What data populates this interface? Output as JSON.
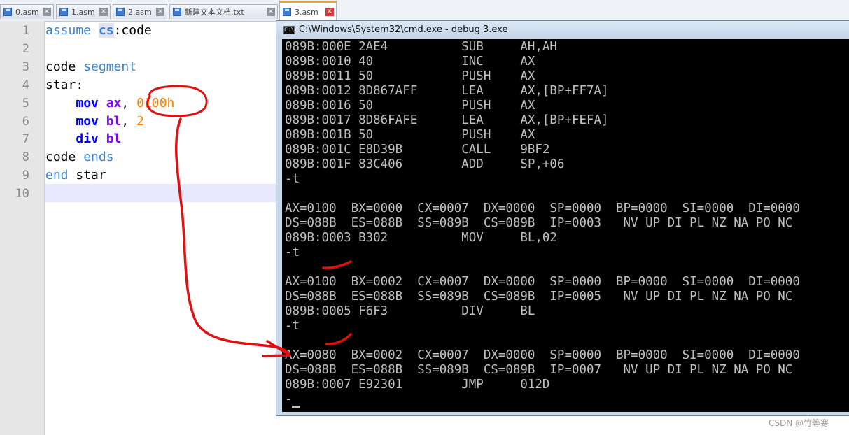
{
  "tabs": [
    {
      "label": "0.asm",
      "active": false
    },
    {
      "label": "1.asm",
      "active": false
    },
    {
      "label": "2.asm",
      "active": false
    },
    {
      "label": "新建文本文档.txt",
      "active": false
    },
    {
      "label": "3.asm",
      "active": true
    }
  ],
  "editor": {
    "line_numbers": [
      "1",
      "2",
      "3",
      "4",
      "5",
      "6",
      "7",
      "8",
      "9",
      "10"
    ],
    "lines": [
      {
        "kw": "assume",
        "sp": " ",
        "seg": "cs",
        "rest": ":code"
      },
      {},
      {
        "name": "code",
        "sp": " ",
        "kw": "segment"
      },
      {
        "label": "star:"
      },
      {
        "indent": "    ",
        "op": "mov",
        "sp": " ",
        "reg": "ax",
        "sep": ", ",
        "num": "0100h"
      },
      {
        "indent": "    ",
        "op": "mov",
        "sp": " ",
        "reg": "bl",
        "sep": ", ",
        "num": "2"
      },
      {
        "indent": "    ",
        "op": "div",
        "sp": " ",
        "reg": "bl"
      },
      {
        "name": "code",
        "sp": " ",
        "kw": "ends"
      },
      {
        "kw": "end",
        "sp": " ",
        "rest": "star"
      },
      {}
    ]
  },
  "cmd": {
    "title": "C:\\Windows\\System32\\cmd.exe - debug  3.exe",
    "icon": "console-icon",
    "lines": [
      "089B:000E 2AE4          SUB     AH,AH",
      "089B:0010 40            INC     AX",
      "089B:0011 50            PUSH    AX",
      "089B:0012 8D867AFF      LEA     AX,[BP+FF7A]",
      "089B:0016 50            PUSH    AX",
      "089B:0017 8D86FAFE      LEA     AX,[BP+FEFA]",
      "089B:001B 50            PUSH    AX",
      "089B:001C E8D39B        CALL    9BF2",
      "089B:001F 83C406        ADD     SP,+06",
      "-t",
      "",
      "AX=0100  BX=0000  CX=0007  DX=0000  SP=0000  BP=0000  SI=0000  DI=0000",
      "DS=088B  ES=088B  SS=089B  CS=089B  IP=0003   NV UP DI PL NZ NA PO NC",
      "089B:0003 B302          MOV     BL,02",
      "-t",
      "",
      "AX=0100  BX=0002  CX=0007  DX=0000  SP=0000  BP=0000  SI=0000  DI=0000",
      "DS=088B  ES=088B  SS=089B  CS=089B  IP=0005   NV UP DI PL NZ NA PO NC",
      "089B:0005 F6F3          DIV     BL",
      "-t",
      "",
      "AX=0080  BX=0002  CX=0007  DX=0000  SP=0000  BP=0000  SI=0000  DI=0000",
      "DS=088B  ES=088B  SS=089B  CS=089B  IP=0007   NV UP DI PL NZ NA PO NC",
      "089B:0007 E92301        JMP     012D",
      "-"
    ]
  },
  "colors": {
    "annotation": "#e01010",
    "console_text": "#c0c0c0",
    "console_bg": "#000000",
    "active_tab_accent": "#f0a030"
  },
  "watermark": "CSDN @竹等寒"
}
